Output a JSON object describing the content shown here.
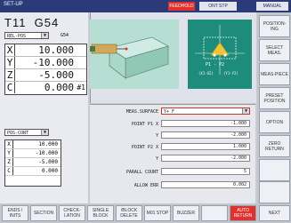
{
  "titlebar": {
    "mode": "SET-UP",
    "status_a": "FEEDHOLD",
    "status_b": "ONT STP",
    "status_c": "MANUAL"
  },
  "left": {
    "tool": "T11",
    "gcode": "G54",
    "coord_select": "REL-POS",
    "coord_select_extra": "G54",
    "positions": [
      {
        "axis": "X",
        "value": "10.000",
        "suffix": ""
      },
      {
        "axis": "Y",
        "value": "-10.000",
        "suffix": ""
      },
      {
        "axis": "Z",
        "value": "-5.000",
        "suffix": ""
      },
      {
        "axis": "C",
        "value": "0.000",
        "suffix": "#1"
      }
    ],
    "cont_select": "POS-CONT",
    "cont_positions": [
      {
        "axis": "X",
        "value": "10.000"
      },
      {
        "axis": "Y",
        "value": "-10.000"
      },
      {
        "axis": "Z",
        "value": "-5.000"
      },
      {
        "axis": "C",
        "value": "0.000"
      }
    ]
  },
  "graphic": {
    "p_label": "P1 - P2",
    "x_label": "(X1-X2)",
    "y_label": "(Y1-Y2)"
  },
  "form": {
    "meas_surface_label": "MEAS.SURFACE",
    "meas_surface_value": "Y+ F",
    "fields": [
      {
        "label": "POINT P1 X",
        "value": "-1.000"
      },
      {
        "label": "Y",
        "value": "-2.000"
      },
      {
        "label": "POINT P2 X",
        "value": "1.000"
      },
      {
        "label": "Y",
        "value": "-2.000"
      },
      {
        "label": "PARALL COUNT",
        "value": "5"
      },
      {
        "label": "ALLOW ERR",
        "value": "0.002"
      }
    ]
  },
  "sidemenu": [
    "POSITION- ING",
    "SELECT MEAS.",
    "MEAS-PIECE",
    "PRESET POSITION",
    "OPTION",
    "ZERO RETURN"
  ],
  "softkeys": [
    "ENDS / INITS",
    "SECTION",
    "CHECK- LATION",
    "SINGLE BLOCK",
    "/BLOCK DELETE",
    "M01 STOP",
    "BUZZER",
    "",
    "AUTO RETURN",
    "NEXT"
  ]
}
